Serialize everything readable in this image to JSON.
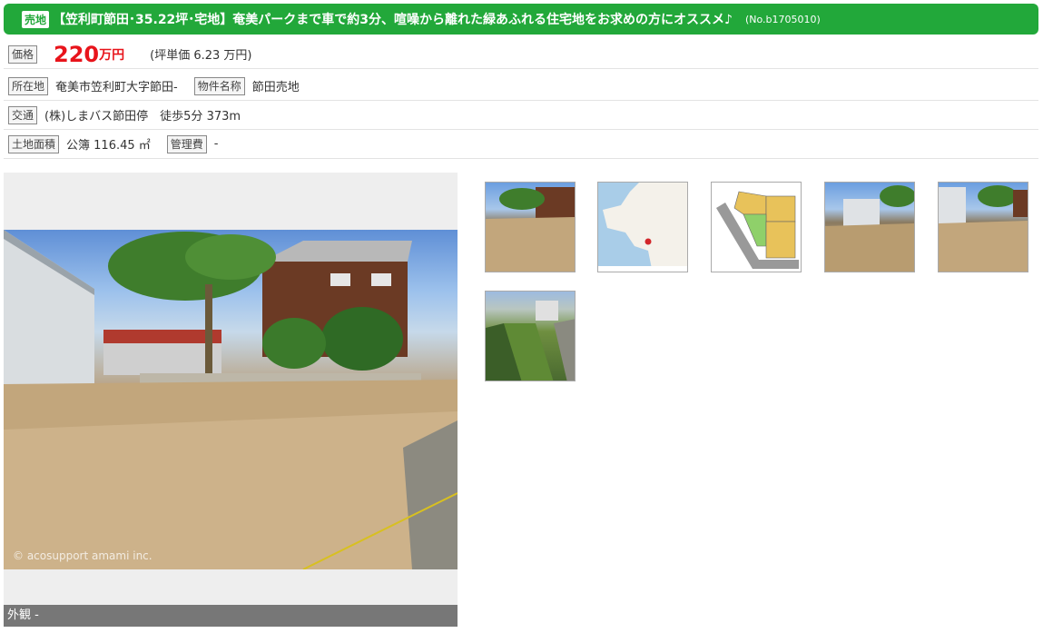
{
  "title": {
    "badge": "売地",
    "text": "【笠利町節田･35.22坪･宅地】奄美パークまで車で約3分、喧噪から離れた緑あふれる住宅地をお求めの方にオススメ♪",
    "number": "(No.b1705010)"
  },
  "price": {
    "label": "価格",
    "value": "220",
    "unit": "万円",
    "per_tsubo": "(坪単価 6.23 万円)"
  },
  "location": {
    "label": "所在地",
    "value": "奄美市笠利町大字節田-",
    "name_label": "物件名称",
    "name_value": "節田売地"
  },
  "transport": {
    "label": "交通",
    "value": "(株)しまバス節田停　徒歩5分 373m"
  },
  "land": {
    "label": "土地面積",
    "value": "公簿 116.45 ㎡",
    "mgmt_label": "管理費",
    "mgmt_value": "-"
  },
  "main_photo": {
    "caption": "外観 -",
    "watermark": "© acosupport amami inc."
  },
  "thumbnails": [
    {
      "kind": "photo"
    },
    {
      "kind": "map"
    },
    {
      "kind": "plot"
    },
    {
      "kind": "photo"
    },
    {
      "kind": "photo"
    },
    {
      "kind": "canal"
    }
  ],
  "colors": {
    "accent_green": "#22a83a",
    "price_red": "#e8141b"
  }
}
